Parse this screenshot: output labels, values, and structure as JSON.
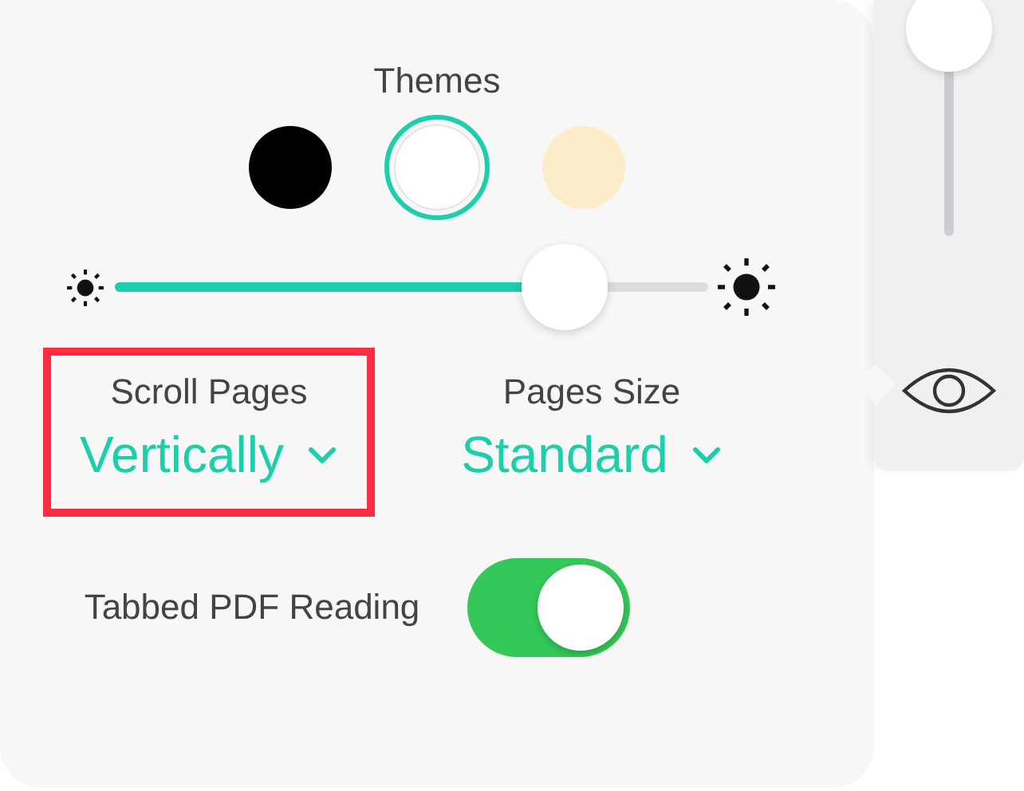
{
  "themes": {
    "title": "Themes",
    "items": [
      {
        "color": "#000000",
        "selected": false
      },
      {
        "color": "#ffffff",
        "selected": true
      },
      {
        "color": "#fdecc8",
        "selected": false
      }
    ]
  },
  "brightness": {
    "level": 0.76
  },
  "options": [
    {
      "label": "Scroll Pages",
      "value": "Vertically",
      "highlighted": true
    },
    {
      "label": "Pages Size",
      "value": "Standard",
      "highlighted": false
    }
  ],
  "tabbed_reading": {
    "label": "Tabbed PDF Reading",
    "on": true
  },
  "side_panel": {
    "level": 1
  }
}
